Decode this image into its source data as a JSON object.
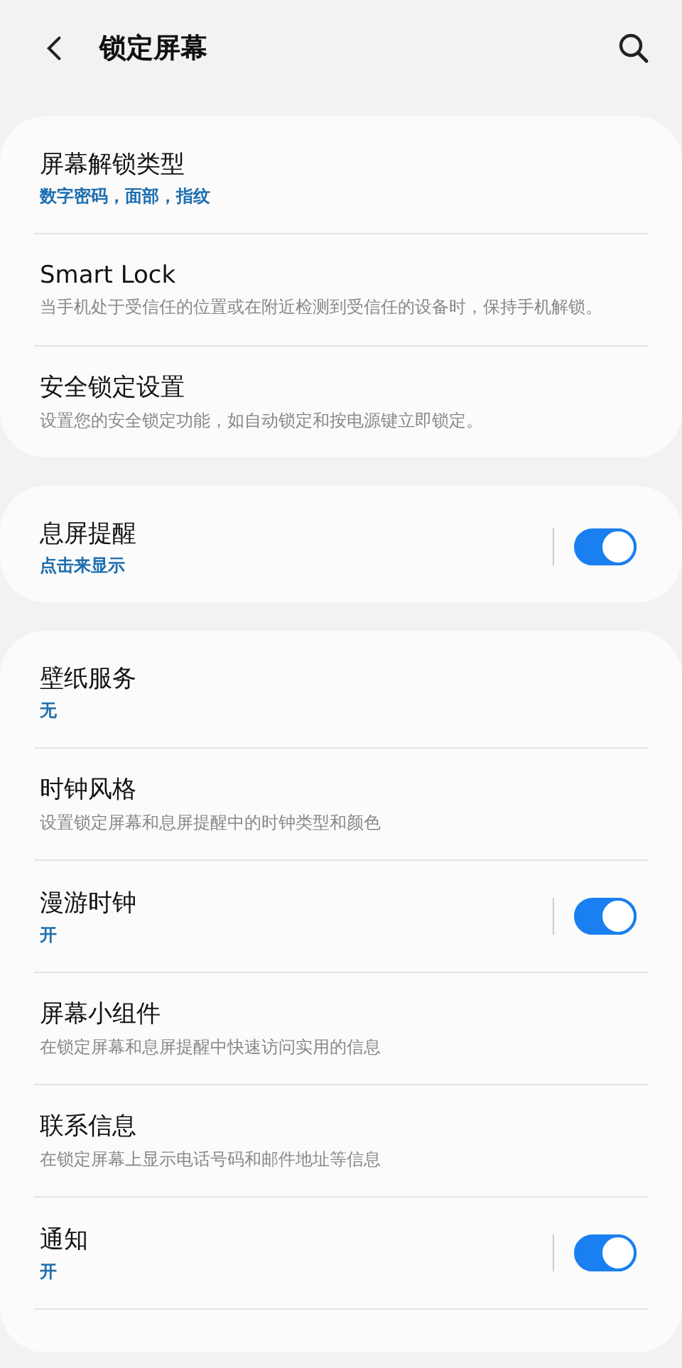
{
  "header": {
    "title": "锁定屏幕"
  },
  "groups": [
    {
      "items": [
        {
          "kind": "text",
          "title": "屏幕解锁类型",
          "summary": "数字密码，面部，指纹"
        },
        {
          "kind": "text",
          "title": "Smart Lock",
          "description": "当手机处于受信任的位置或在附近检测到受信任的设备时，保持手机解锁。"
        },
        {
          "kind": "text",
          "title": "安全锁定设置",
          "description": "设置您的安全锁定功能，如自动锁定和按电源键立即锁定。"
        }
      ]
    },
    {
      "items": [
        {
          "kind": "toggle",
          "title": "息屏提醒",
          "summary": "点击来显示",
          "on": true
        }
      ]
    },
    {
      "items": [
        {
          "kind": "text",
          "title": "壁纸服务",
          "summary": "无"
        },
        {
          "kind": "text",
          "title": "时钟风格",
          "description": "设置锁定屏幕和息屏提醒中的时钟类型和颜色"
        },
        {
          "kind": "toggle",
          "title": "漫游时钟",
          "summary": "开",
          "on": true
        },
        {
          "kind": "text",
          "title": "屏幕小组件",
          "description": "在锁定屏幕和息屏提醒中快速访问实用的信息"
        },
        {
          "kind": "text",
          "title": "联系信息",
          "description": "在锁定屏幕上显示电话号码和邮件地址等信息"
        },
        {
          "kind": "toggle",
          "title": "通知",
          "summary": "开",
          "on": true
        },
        {
          "kind": "cut"
        }
      ]
    }
  ]
}
